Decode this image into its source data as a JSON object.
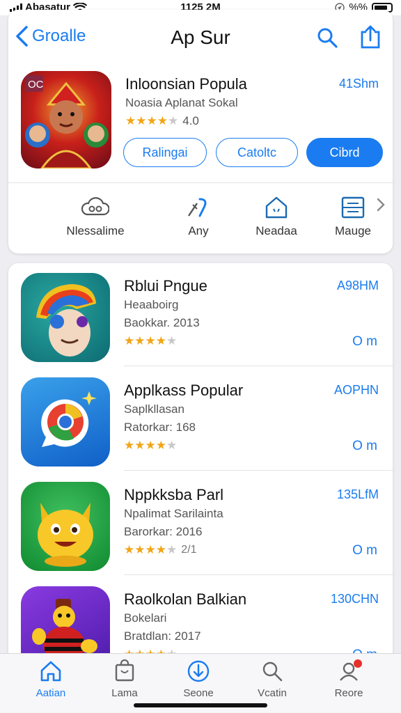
{
  "status": {
    "carrier": "Abasatur",
    "time": "1125 2M",
    "battery": "%%"
  },
  "nav": {
    "back_label": "Groalle",
    "title": "Ap Sur"
  },
  "featured": {
    "name": "Inloonsian Popula",
    "subtitle": "Noasia Aplanat Sokal",
    "rating": "4.0",
    "size": "41Shm",
    "buttons": [
      "Ralingai",
      "Catoltc",
      "Cibrd"
    ]
  },
  "categories": [
    {
      "label": "Nlessalime",
      "icon": "cloud-people-icon"
    },
    {
      "label": "Any",
      "icon": "sparkle-icon"
    },
    {
      "label": "Neadaa",
      "icon": "house-icon"
    },
    {
      "label": "Mauge",
      "icon": "window-icon"
    }
  ],
  "apps": [
    {
      "name": "Rblui Pngue",
      "subtitle": "Heaaboirg",
      "year": "Baokkar. 2013",
      "size": "A98HM",
      "rating_text": "",
      "action": "O m",
      "stars": 4.5,
      "icon": "rainbow-hair-character-icon"
    },
    {
      "name": "Applkass Popular",
      "subtitle": "Saplkllasan",
      "year": "Ratorkar: 168",
      "size": "AOPHN",
      "rating_text": "",
      "action": "O m",
      "stars": 4.5,
      "icon": "browser-globe-icon"
    },
    {
      "name": "Nppkksba Parl",
      "subtitle": "Npalimat Sarilainta",
      "year": "Barorkar: 2016",
      "size": "135LfM",
      "rating_text": "2/1",
      "action": "O m",
      "stars": 4.5,
      "icon": "yellow-cat-character-icon"
    },
    {
      "name": "Raolkolan Balkian",
      "subtitle": "Bokelari",
      "year": "Bratdlan: 2017",
      "size": "130CHN",
      "rating_text": "",
      "action": "O m",
      "stars": 4.5,
      "icon": "arcade-character-icon"
    }
  ],
  "tabs": [
    {
      "label": "Aatian",
      "icon": "home-icon",
      "active": true
    },
    {
      "label": "Lama",
      "icon": "bag-icon",
      "active": false
    },
    {
      "label": "Seone",
      "icon": "download-icon",
      "active": false
    },
    {
      "label": "Vcatin",
      "icon": "search-icon",
      "active": false
    },
    {
      "label": "Reore",
      "icon": "profile-icon",
      "active": false
    }
  ],
  "colors": {
    "accent": "#1a7cf0",
    "star": "#f2a516",
    "badge": "#e8302a"
  }
}
